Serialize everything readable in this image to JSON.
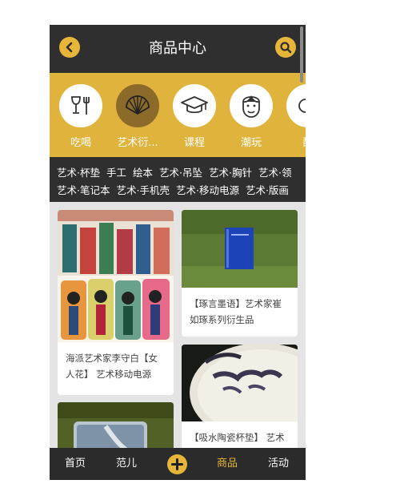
{
  "header": {
    "title": "商品中心",
    "back_icon": "chevron-left-icon",
    "search_icon": "search-icon"
  },
  "categories": [
    {
      "label": "吃喝",
      "icon": "wine-fork-icon",
      "active": false
    },
    {
      "label": "艺术衍...",
      "icon": "folding-fan-icon",
      "active": true
    },
    {
      "label": "课程",
      "icon": "graduation-cap-icon",
      "active": false
    },
    {
      "label": "潮玩",
      "icon": "face-icon",
      "active": false
    },
    {
      "label": "配",
      "icon": "accessory-icon",
      "active": false
    }
  ],
  "tags": {
    "row1": [
      "艺术·杯垫",
      "手工",
      "绘本",
      "艺术·吊坠",
      "艺术·胸针",
      "艺术·领"
    ],
    "row2": [
      "艺术·笔记本",
      "艺术·手机壳",
      "艺术·移动电源",
      "艺术·版画"
    ]
  },
  "products": [
    {
      "title": "海派艺术家李守白【女人花】 艺术移动电源"
    },
    {
      "title": "【琢言墨语】艺术家崔如琢系列衍生品"
    },
    {
      "title": "【吸水陶瓷杯垫】 艺术家崔如琢系列衍生品"
    },
    {
      "title": ""
    }
  ],
  "bottom_nav": {
    "home": "首页",
    "fan": "范儿",
    "products": "商品",
    "events": "活动",
    "add_icon": "plus-icon"
  },
  "colors": {
    "accent": "#e6b53a",
    "dark": "#2f2f2f",
    "category_bg": "#e0b43c"
  }
}
